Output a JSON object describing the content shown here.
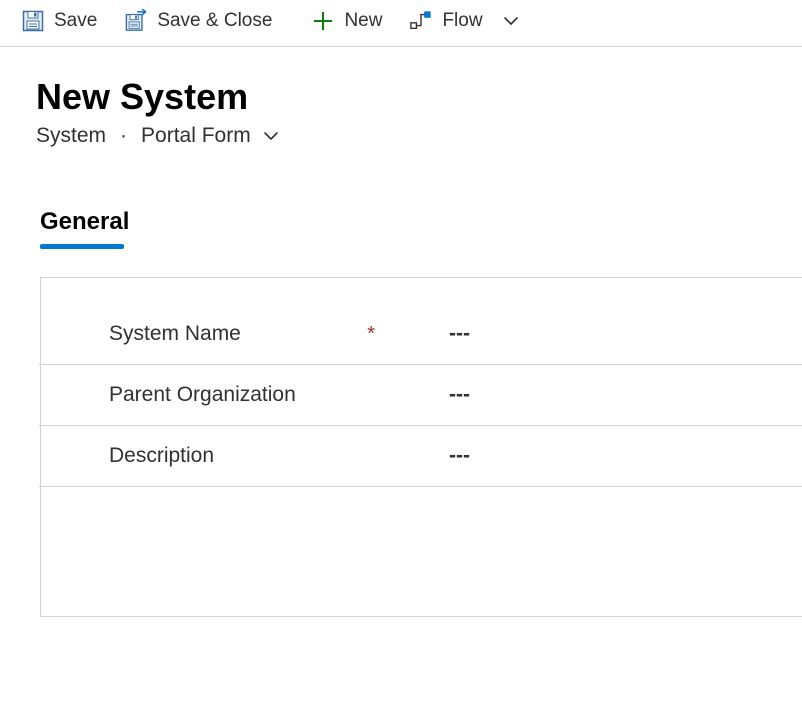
{
  "toolbar": {
    "save_label": "Save",
    "save_close_label": "Save & Close",
    "new_label": "New",
    "flow_label": "Flow"
  },
  "header": {
    "title": "New System",
    "entity": "System",
    "form_name": "Portal Form"
  },
  "tabs": {
    "general_label": "General"
  },
  "form": {
    "rows": [
      {
        "label": "System Name",
        "required": true,
        "value": "---"
      },
      {
        "label": "Parent Organization",
        "required": false,
        "value": "---"
      },
      {
        "label": "Description",
        "required": false,
        "value": "---"
      }
    ],
    "required_mark": "*"
  }
}
